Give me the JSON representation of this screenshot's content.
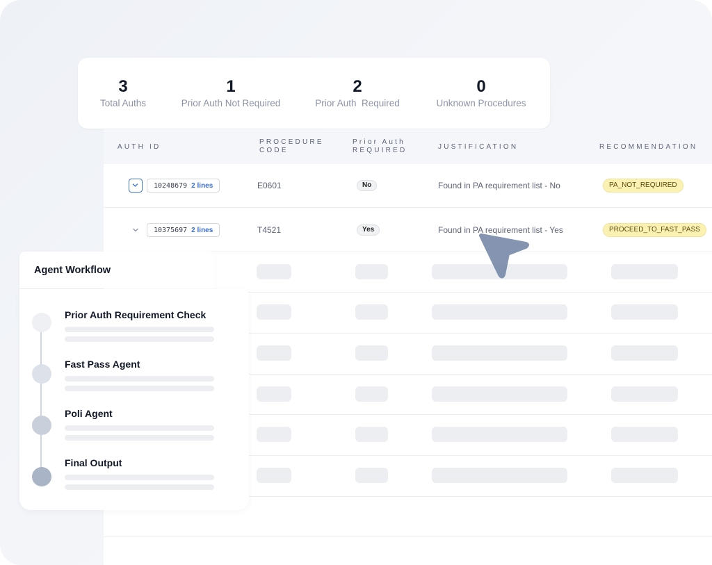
{
  "stats": [
    {
      "value": "3",
      "label": "Total Auths"
    },
    {
      "value": "1",
      "label": "Prior Auth Not Required"
    },
    {
      "value": "2",
      "label": "Prior Auth  Required"
    },
    {
      "value": "0",
      "label": "Unknown Procedures"
    }
  ],
  "table": {
    "headers": {
      "auth_id": "AUTH ID",
      "procedure_code": "PROCEDURE CODE",
      "prior_auth_required": "Prior Auth REQUIRED",
      "justification": "JUSTIFICATION",
      "recommendation": "RECOMMENDATION"
    },
    "rows": [
      {
        "auth_id": "10248679",
        "lines": "2 lines",
        "procedure_code": "E0601",
        "prior_auth_required": "No",
        "justification": "Found in PA requirement list - No",
        "recommendation": "PA_NOT_REQUIRED"
      },
      {
        "auth_id": "10375697",
        "lines": "2 lines",
        "procedure_code": "T4521",
        "prior_auth_required": "Yes",
        "justification": "Found in PA requirement list - Yes",
        "recommendation": "PROCEED_TO_FAST_PASS"
      }
    ]
  },
  "workflow": {
    "title": "Agent Workflow",
    "steps": [
      {
        "label": "Prior Auth Requirement Check"
      },
      {
        "label": "Fast Pass Agent"
      },
      {
        "label": "Poli Agent"
      },
      {
        "label": "Final Output"
      }
    ]
  },
  "colors": {
    "accent_blue": "#3b6fd0",
    "recommendation_bg": "#fbf1b3",
    "cursor": "#7a8cab"
  },
  "icons": {
    "expand": "chevron-down-icon",
    "pointer": "cursor-arrow-icon"
  }
}
